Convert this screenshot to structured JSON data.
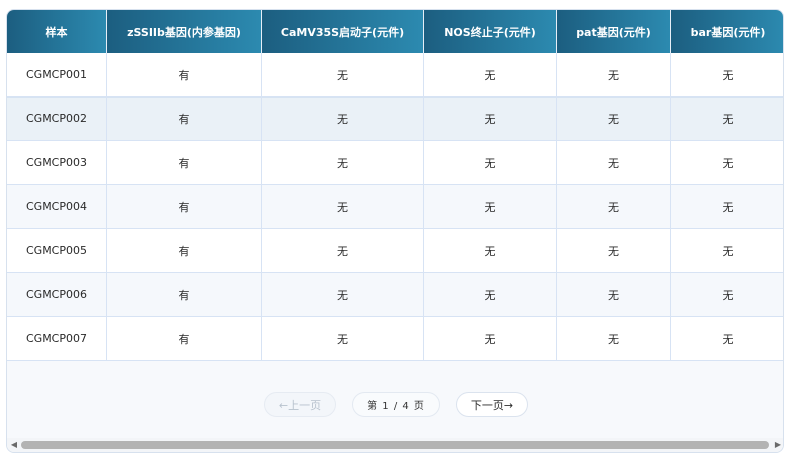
{
  "table": {
    "headers": [
      "样本",
      "zSSIIb基因(内参基因)",
      "CaMV35S启动子(元件)",
      "NOS终止子(元件)",
      "pat基因(元件)",
      "bar基因(元件)"
    ],
    "rows": [
      [
        "CGMCP001",
        "有",
        "无",
        "无",
        "无",
        "无"
      ],
      [
        "CGMCP002",
        "有",
        "无",
        "无",
        "无",
        "无"
      ],
      [
        "CGMCP003",
        "有",
        "无",
        "无",
        "无",
        "无"
      ],
      [
        "CGMCP004",
        "有",
        "无",
        "无",
        "无",
        "无"
      ],
      [
        "CGMCP005",
        "有",
        "无",
        "无",
        "无",
        "无"
      ],
      [
        "CGMCP006",
        "有",
        "无",
        "无",
        "无",
        "无"
      ],
      [
        "CGMCP007",
        "有",
        "无",
        "无",
        "无",
        "无"
      ]
    ]
  },
  "pagination": {
    "prev_label": "←上一页",
    "page_info": "第 1 / 4 页",
    "next_label": "下一页→"
  },
  "colors": {
    "header_start": "#1c5e80",
    "header_end": "#2c8ab0"
  }
}
